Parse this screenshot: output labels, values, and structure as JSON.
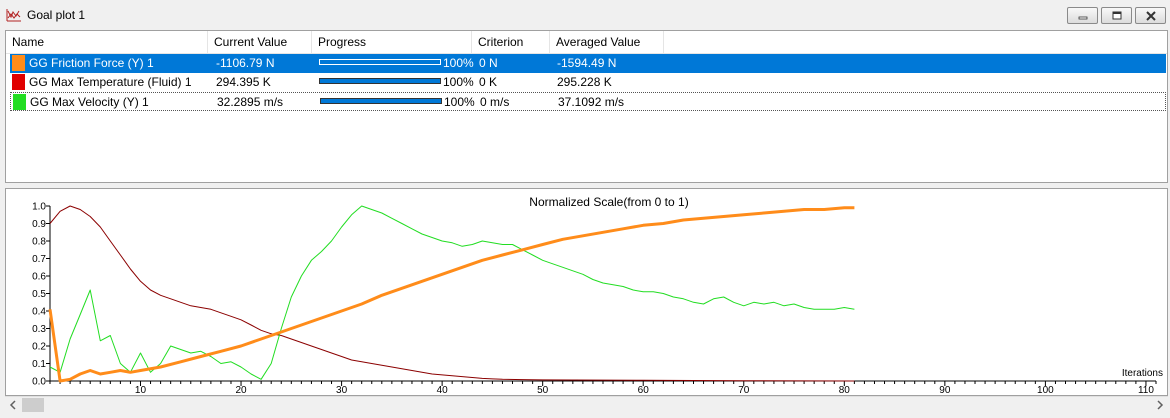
{
  "window": {
    "title": "Goal plot 1",
    "icon": "goal-plot-icon",
    "buttons": [
      "minimize-icon",
      "restore-icon",
      "close-icon"
    ]
  },
  "table": {
    "columns": [
      "Name",
      "Current Value",
      "Progress",
      "Criterion",
      "Averaged Value"
    ],
    "rows": [
      {
        "name": "GG Friction Force (Y) 1",
        "current": "-1106.79 N",
        "progress_label": "100%",
        "progress": 1.0,
        "criterion": "0 N",
        "averaged": "-1594.49 N",
        "color": "#ff8c1a",
        "selected": true,
        "focused": false
      },
      {
        "name": "GG Max Temperature (Fluid) 1",
        "current": "294.395 K",
        "progress_label": "100%",
        "progress": 1.0,
        "criterion": "0 K",
        "averaged": "295.228 K",
        "color": "#e00000",
        "selected": false,
        "focused": false
      },
      {
        "name": "GG Max Velocity (Y) 1",
        "current": "32.2895 m/s",
        "progress_label": "100%",
        "progress": 1.0,
        "criterion": "0 m/s",
        "averaged": "37.1092 m/s",
        "color": "#22dd22",
        "selected": false,
        "focused": true
      }
    ]
  },
  "chart_data": {
    "type": "line",
    "title": "Normalized Scale(from 0 to 1)",
    "xlabel": "Iterations",
    "ylabel": "",
    "xlim": [
      1,
      111
    ],
    "ylim": [
      0,
      1
    ],
    "x_ticks": [
      10,
      20,
      30,
      40,
      50,
      60,
      70,
      80,
      90,
      100,
      110
    ],
    "y_ticks": [
      0.0,
      0.1,
      0.2,
      0.3,
      0.4,
      0.5,
      0.6,
      0.7,
      0.8,
      0.9,
      1.0
    ],
    "grid": false,
    "series": [
      {
        "color": "#8b0000",
        "points": [
          [
            1,
            0.9
          ],
          [
            2,
            0.97
          ],
          [
            3,
            1.0
          ],
          [
            4,
            0.98
          ],
          [
            5,
            0.94
          ],
          [
            6,
            0.88
          ],
          [
            7,
            0.8
          ],
          [
            8,
            0.72
          ],
          [
            9,
            0.64
          ],
          [
            10,
            0.57
          ],
          [
            11,
            0.52
          ],
          [
            12,
            0.49
          ],
          [
            13,
            0.47
          ],
          [
            14,
            0.45
          ],
          [
            15,
            0.43
          ],
          [
            16,
            0.42
          ],
          [
            17,
            0.41
          ],
          [
            18,
            0.39
          ],
          [
            19,
            0.37
          ],
          [
            20,
            0.35
          ],
          [
            21,
            0.32
          ],
          [
            22,
            0.29
          ],
          [
            23,
            0.27
          ],
          [
            24,
            0.26
          ],
          [
            25,
            0.24
          ],
          [
            26,
            0.22
          ],
          [
            27,
            0.2
          ],
          [
            28,
            0.18
          ],
          [
            29,
            0.16
          ],
          [
            30,
            0.14
          ],
          [
            31,
            0.12
          ],
          [
            32,
            0.11
          ],
          [
            33,
            0.1
          ],
          [
            34,
            0.09
          ],
          [
            35,
            0.08
          ],
          [
            36,
            0.07
          ],
          [
            37,
            0.06
          ],
          [
            38,
            0.05
          ],
          [
            39,
            0.04
          ],
          [
            40,
            0.035
          ],
          [
            41,
            0.03
          ],
          [
            42,
            0.025
          ],
          [
            43,
            0.02
          ],
          [
            44,
            0.015
          ],
          [
            45,
            0.012
          ],
          [
            46,
            0.01
          ],
          [
            48,
            0.008
          ],
          [
            50,
            0.006
          ],
          [
            60,
            0.004
          ],
          [
            70,
            0.002
          ],
          [
            81,
            0.0
          ]
        ]
      },
      {
        "color": "#22dd22",
        "points": [
          [
            1,
            0.08
          ],
          [
            2,
            0.05
          ],
          [
            3,
            0.24
          ],
          [
            4,
            0.38
          ],
          [
            5,
            0.52
          ],
          [
            6,
            0.23
          ],
          [
            7,
            0.26
          ],
          [
            8,
            0.1
          ],
          [
            9,
            0.05
          ],
          [
            10,
            0.16
          ],
          [
            11,
            0.05
          ],
          [
            12,
            0.1
          ],
          [
            13,
            0.2
          ],
          [
            14,
            0.18
          ],
          [
            15,
            0.16
          ],
          [
            16,
            0.17
          ],
          [
            17,
            0.14
          ],
          [
            18,
            0.1
          ],
          [
            19,
            0.11
          ],
          [
            20,
            0.08
          ],
          [
            21,
            0.04
          ],
          [
            22,
            0.01
          ],
          [
            23,
            0.1
          ],
          [
            24,
            0.3
          ],
          [
            25,
            0.48
          ],
          [
            26,
            0.6
          ],
          [
            27,
            0.69
          ],
          [
            28,
            0.74
          ],
          [
            29,
            0.8
          ],
          [
            30,
            0.88
          ],
          [
            31,
            0.95
          ],
          [
            32,
            1.0
          ],
          [
            33,
            0.98
          ],
          [
            34,
            0.96
          ],
          [
            35,
            0.93
          ],
          [
            36,
            0.9
          ],
          [
            37,
            0.87
          ],
          [
            38,
            0.84
          ],
          [
            39,
            0.82
          ],
          [
            40,
            0.8
          ],
          [
            41,
            0.79
          ],
          [
            42,
            0.77
          ],
          [
            43,
            0.78
          ],
          [
            44,
            0.8
          ],
          [
            45,
            0.79
          ],
          [
            46,
            0.78
          ],
          [
            47,
            0.78
          ],
          [
            48,
            0.75
          ],
          [
            49,
            0.72
          ],
          [
            50,
            0.69
          ],
          [
            51,
            0.67
          ],
          [
            52,
            0.65
          ],
          [
            53,
            0.63
          ],
          [
            54,
            0.61
          ],
          [
            55,
            0.58
          ],
          [
            56,
            0.56
          ],
          [
            57,
            0.55
          ],
          [
            58,
            0.54
          ],
          [
            59,
            0.52
          ],
          [
            60,
            0.51
          ],
          [
            61,
            0.51
          ],
          [
            62,
            0.5
          ],
          [
            63,
            0.48
          ],
          [
            64,
            0.47
          ],
          [
            65,
            0.45
          ],
          [
            66,
            0.44
          ],
          [
            67,
            0.47
          ],
          [
            68,
            0.48
          ],
          [
            69,
            0.45
          ],
          [
            70,
            0.43
          ],
          [
            71,
            0.45
          ],
          [
            72,
            0.44
          ],
          [
            73,
            0.45
          ],
          [
            74,
            0.43
          ],
          [
            75,
            0.44
          ],
          [
            76,
            0.42
          ],
          [
            77,
            0.41
          ],
          [
            78,
            0.41
          ],
          [
            79,
            0.41
          ],
          [
            80,
            0.42
          ],
          [
            81,
            0.41
          ]
        ]
      },
      {
        "color": "#ff8c1a",
        "points": [
          [
            1,
            0.41
          ],
          [
            2,
            0.0
          ],
          [
            3,
            0.01
          ],
          [
            4,
            0.04
          ],
          [
            5,
            0.06
          ],
          [
            6,
            0.04
          ],
          [
            7,
            0.05
          ],
          [
            8,
            0.06
          ],
          [
            9,
            0.05
          ],
          [
            10,
            0.06
          ],
          [
            12,
            0.08
          ],
          [
            14,
            0.11
          ],
          [
            16,
            0.14
          ],
          [
            18,
            0.17
          ],
          [
            20,
            0.2
          ],
          [
            22,
            0.24
          ],
          [
            24,
            0.28
          ],
          [
            26,
            0.32
          ],
          [
            28,
            0.36
          ],
          [
            30,
            0.4
          ],
          [
            32,
            0.44
          ],
          [
            34,
            0.49
          ],
          [
            36,
            0.53
          ],
          [
            38,
            0.57
          ],
          [
            40,
            0.61
          ],
          [
            42,
            0.65
          ],
          [
            44,
            0.69
          ],
          [
            46,
            0.72
          ],
          [
            48,
            0.75
          ],
          [
            50,
            0.78
          ],
          [
            52,
            0.81
          ],
          [
            54,
            0.83
          ],
          [
            56,
            0.85
          ],
          [
            58,
            0.87
          ],
          [
            60,
            0.89
          ],
          [
            62,
            0.9
          ],
          [
            64,
            0.92
          ],
          [
            66,
            0.93
          ],
          [
            68,
            0.94
          ],
          [
            70,
            0.95
          ],
          [
            72,
            0.96
          ],
          [
            74,
            0.97
          ],
          [
            76,
            0.98
          ],
          [
            78,
            0.98
          ],
          [
            80,
            0.99
          ],
          [
            81,
            0.99
          ]
        ]
      }
    ]
  },
  "scrollbar": {
    "left_icon": "scroll-left-icon",
    "right_icon": "scroll-right-icon"
  }
}
